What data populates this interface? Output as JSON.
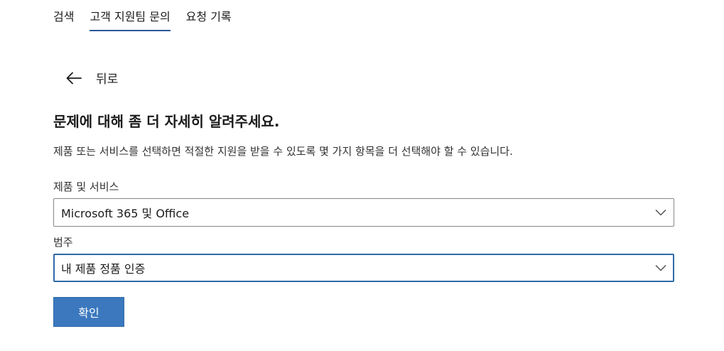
{
  "tabs": [
    {
      "label": "검색",
      "active": false
    },
    {
      "label": "고객 지원팀 문의",
      "active": true
    },
    {
      "label": "요청 기록",
      "active": false
    }
  ],
  "back": {
    "label": "뒤로",
    "icon": "arrow-left-icon"
  },
  "main": {
    "title": "문제에 대해 좀 더 자세히 알려주세요.",
    "description": "제품 또는 서비스를 선택하면 적절한 지원을 받을 수 있도록 몇 가지 항목을 더 선택해야 할 수 있습니다."
  },
  "form": {
    "product": {
      "label": "제품 및 서비스",
      "value": "Microsoft 365 및 Office",
      "icon": "chevron-down-icon"
    },
    "category": {
      "label": "범주",
      "value": "내 제품 정품 인증",
      "icon": "chevron-down-icon"
    },
    "submit_label": "확인"
  },
  "colors": {
    "accent": "#2b579a",
    "button": "#3b78be",
    "focus_border": "#2f6aa8"
  }
}
